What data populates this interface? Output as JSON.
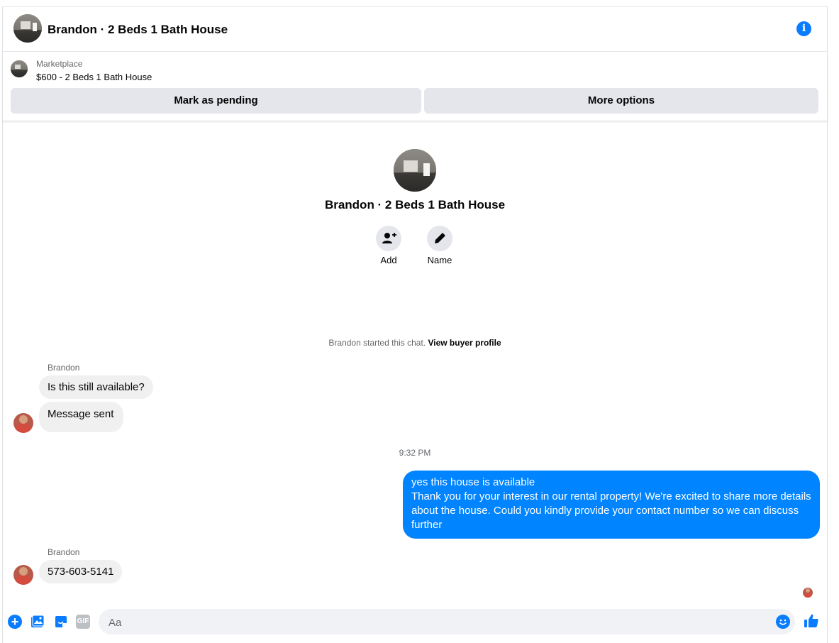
{
  "colors": {
    "accent": "#0084ff",
    "bubble_in": "#f0f0f0",
    "button_bg": "#e4e6eb"
  },
  "header": {
    "title": "Brandon · 2 Beds 1 Bath House",
    "info_icon": "info-icon"
  },
  "marketplace": {
    "label": "Marketplace",
    "listing": "$600 - 2 Beds 1 Bath House",
    "buttons": {
      "pending": "Mark as pending",
      "more": "More options"
    }
  },
  "intro": {
    "title": "Brandon · 2 Beds 1 Bath House",
    "actions": {
      "add": "Add",
      "name": "Name"
    },
    "started_text": "Brandon started this chat.",
    "buyer_link": "View buyer profile"
  },
  "messages": {
    "group1": {
      "sender": "Brandon",
      "msg1": "Is this still available?",
      "msg2": "Message sent"
    },
    "timestamp": "9:32 PM",
    "outgoing": {
      "line1": "yes this house is available",
      "line2": "Thank you for your interest in our rental property! We're excited to share more details about the house. Could you kindly provide your contact number so we can discuss further"
    },
    "group2": {
      "sender": "Brandon",
      "msg1": "573-603-5141"
    }
  },
  "composer": {
    "placeholder": "Aa",
    "gif_label": "GIF"
  }
}
